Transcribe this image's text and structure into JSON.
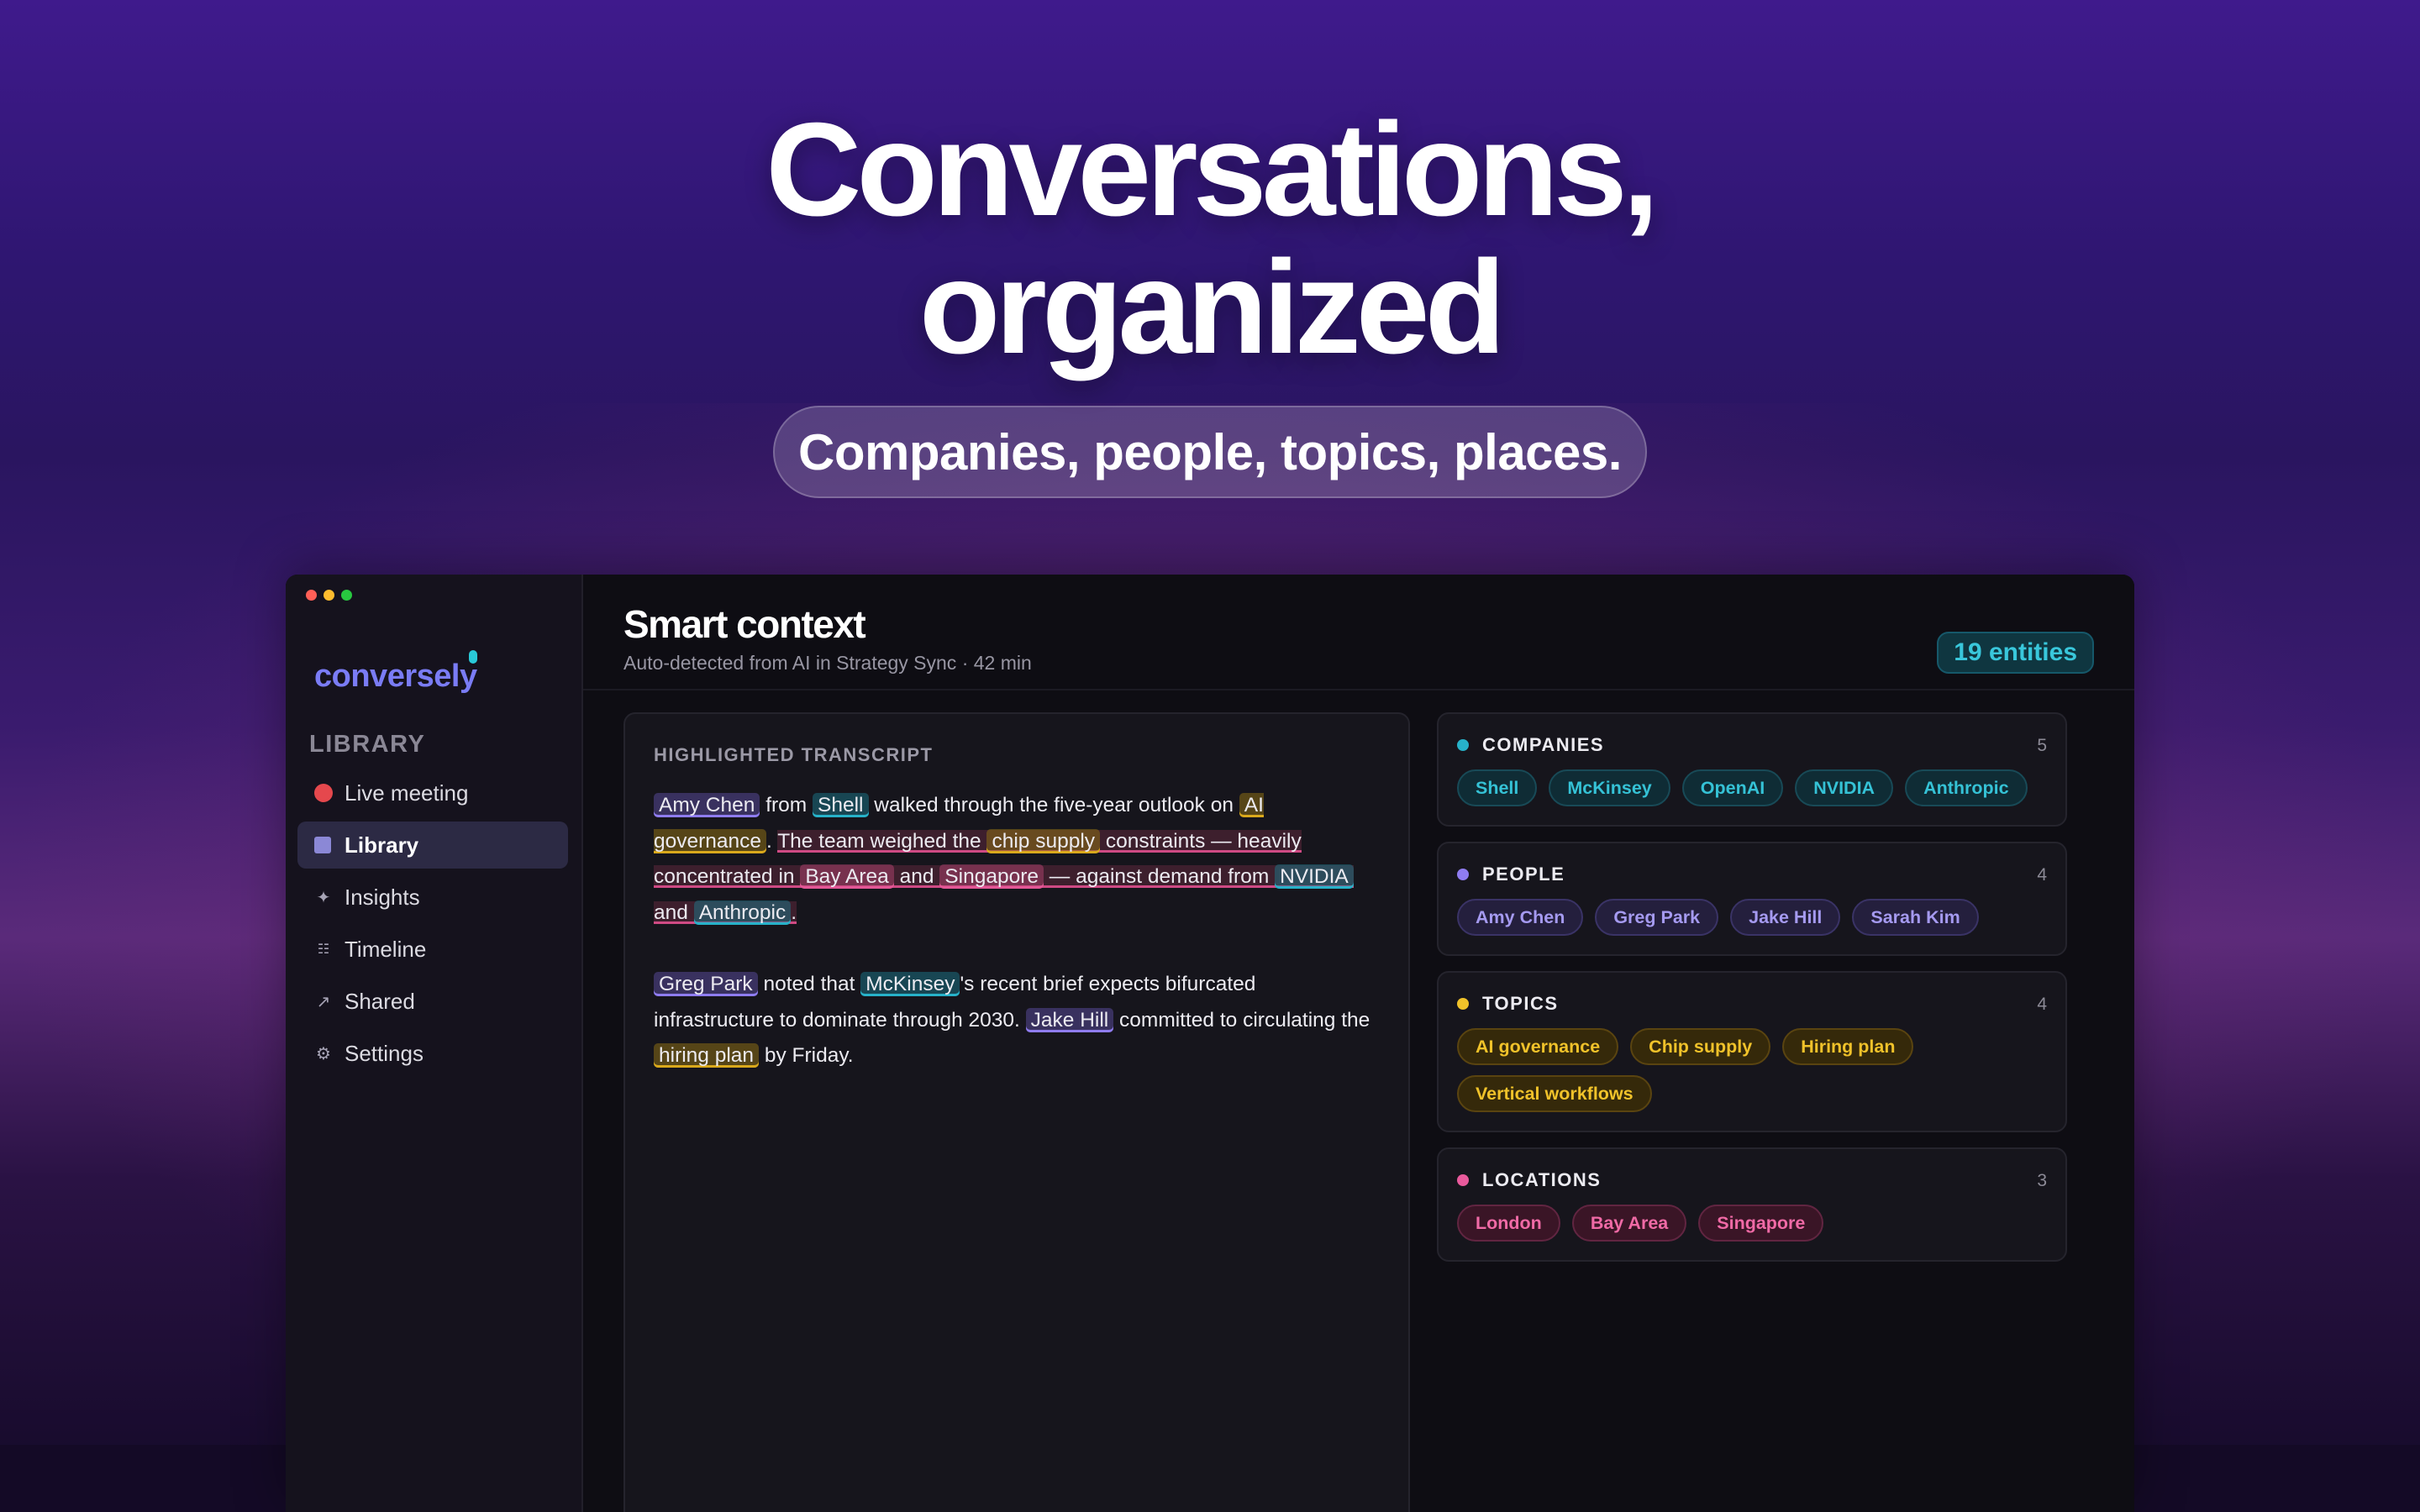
{
  "hero": {
    "title_line1": "Conversations,",
    "title_line2": "organized",
    "subtitle": "Companies, people, topics, places."
  },
  "app": {
    "logo": "conversely",
    "sidebar": {
      "heading": "LIBRARY",
      "items": [
        {
          "label": "Live meeting",
          "icon": "record-dot-icon",
          "active": false
        },
        {
          "label": "Library",
          "icon": "library-square-icon",
          "active": true
        },
        {
          "label": "Insights",
          "icon": "sparkle-icon",
          "active": false
        },
        {
          "label": "Timeline",
          "icon": "timeline-icon",
          "active": false
        },
        {
          "label": "Shared",
          "icon": "arrow-up-right-icon",
          "active": false
        },
        {
          "label": "Settings",
          "icon": "gear-icon",
          "active": false
        }
      ]
    },
    "header": {
      "title": "Smart context",
      "subtitle": "Auto-detected from AI in Strategy Sync · 42 min",
      "entity_count": "19 entities"
    },
    "transcript": {
      "label": "HIGHLIGHTED TRANSCRIPT",
      "p1": {
        "amy": "Amy Chen",
        "t1": " from ",
        "shell": "Shell",
        "t2": " walked through the five-year outlook on ",
        "ai": "AI governance",
        "t3": ". ",
        "t4": "The team weighed the ",
        "chip": "chip supply",
        "t5": " constraints — heavily concentrated in ",
        "bay": "Bay Area",
        "t6": " and ",
        "sg": "Singapore",
        "t7": " — against demand from ",
        "nvidia": "NVIDIA",
        "t8": " and ",
        "anthropic": "Anthropic",
        "t9": "."
      },
      "p2": {
        "greg": "Greg Park",
        "t1": " noted that ",
        "mck": "McKinsey",
        "t2": "'s recent brief expects bifurcated infrastructure to dominate through 2030. ",
        "jake": "Jake Hill",
        "t3": " committed to circulating the ",
        "hiring": "hiring plan",
        "t4": " by Friday."
      }
    },
    "entities": {
      "companies": {
        "title": "COMPANIES",
        "count": "5",
        "color": "#27b2c9",
        "items": [
          "Shell",
          "McKinsey",
          "OpenAI",
          "NVIDIA",
          "Anthropic"
        ]
      },
      "people": {
        "title": "PEOPLE",
        "count": "4",
        "color": "#8f7cf0",
        "items": [
          "Amy Chen",
          "Greg Park",
          "Jake Hill",
          "Sarah Kim"
        ]
      },
      "topics": {
        "title": "TOPICS",
        "count": "4",
        "color": "#f0c22a",
        "items": [
          "AI governance",
          "Chip supply",
          "Hiring plan",
          "Vertical workflows"
        ]
      },
      "locations": {
        "title": "LOCATIONS",
        "count": "3",
        "color": "#e95a9c",
        "items": [
          "London",
          "Bay Area",
          "Singapore"
        ]
      }
    }
  }
}
